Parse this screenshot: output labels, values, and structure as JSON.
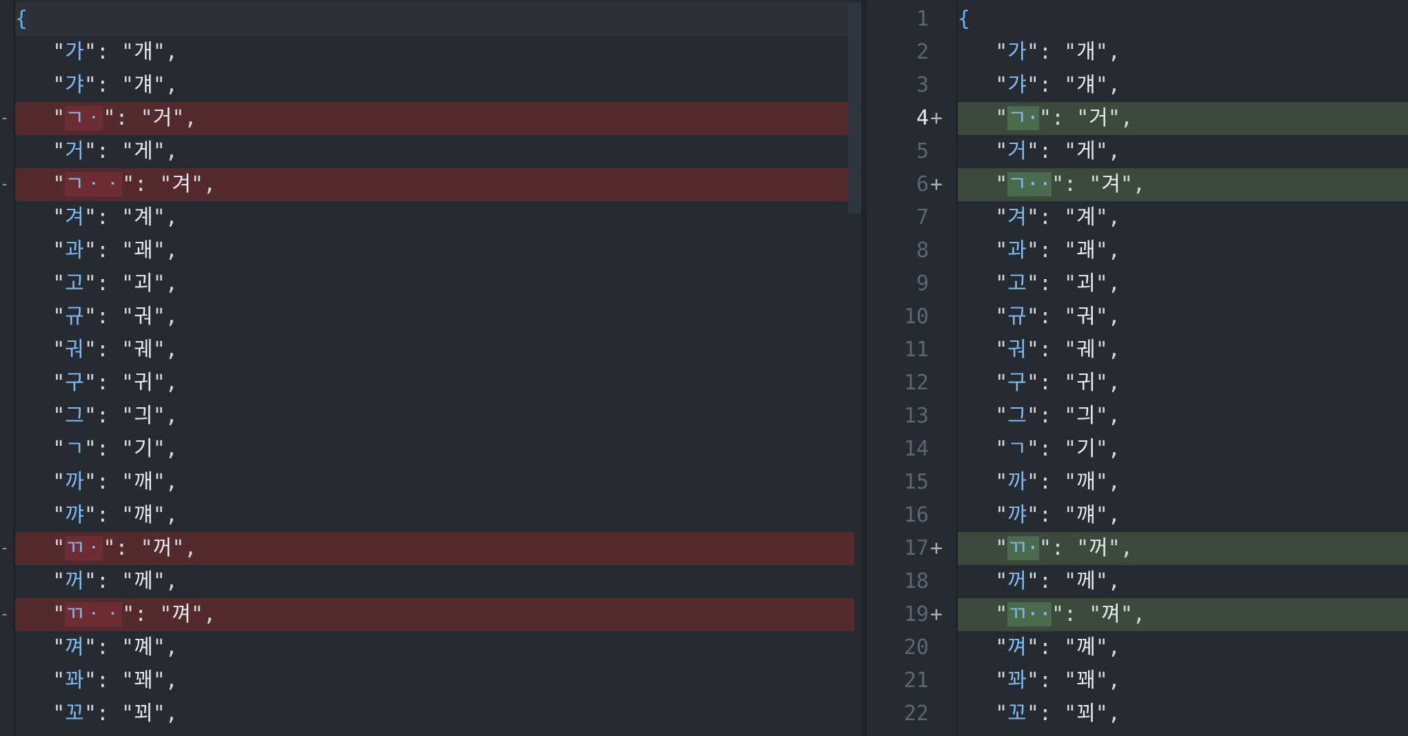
{
  "left": {
    "lines": [
      {
        "type": "brace",
        "text": "{"
      },
      {
        "type": "ctx",
        "key": "가",
        "val": "개"
      },
      {
        "type": "ctx",
        "key": "갸",
        "val": "걔"
      },
      {
        "type": "del",
        "key": "ㄱㆍ",
        "val": "거",
        "hl": "ㄱㆍ"
      },
      {
        "type": "ctx",
        "key": "거",
        "val": "게"
      },
      {
        "type": "del",
        "key": "ㄱㆍㆍ",
        "val": "겨",
        "hl": "ㄱㆍㆍ"
      },
      {
        "type": "ctx",
        "key": "겨",
        "val": "계"
      },
      {
        "type": "ctx",
        "key": "과",
        "val": "괘"
      },
      {
        "type": "ctx",
        "key": "고",
        "val": "괴"
      },
      {
        "type": "ctx",
        "key": "규",
        "val": "궈"
      },
      {
        "type": "ctx",
        "key": "궈",
        "val": "궤"
      },
      {
        "type": "ctx",
        "key": "구",
        "val": "귀"
      },
      {
        "type": "ctx",
        "key": "그",
        "val": "긔"
      },
      {
        "type": "ctx",
        "key": "ㄱ",
        "val": "기"
      },
      {
        "type": "ctx",
        "key": "까",
        "val": "깨"
      },
      {
        "type": "ctx",
        "key": "꺄",
        "val": "꺠"
      },
      {
        "type": "del",
        "key": "ㄲㆍ",
        "val": "꺼",
        "hl": "ㄲㆍ"
      },
      {
        "type": "ctx",
        "key": "꺼",
        "val": "께"
      },
      {
        "type": "del",
        "key": "ㄲㆍㆍ",
        "val": "껴",
        "hl": "ㄲㆍㆍ"
      },
      {
        "type": "ctx",
        "key": "껴",
        "val": "꼐"
      },
      {
        "type": "ctx",
        "key": "꽈",
        "val": "꽤"
      },
      {
        "type": "ctx",
        "key": "꼬",
        "val": "꾀"
      }
    ]
  },
  "right": {
    "lines": [
      {
        "n": "1",
        "type": "brace",
        "text": "{"
      },
      {
        "n": "2",
        "type": "ctx",
        "key": "가",
        "val": "개"
      },
      {
        "n": "3",
        "type": "ctx",
        "key": "갸",
        "val": "걔"
      },
      {
        "n": "4",
        "type": "add",
        "key": "ㄱ·",
        "val": "거",
        "active": true
      },
      {
        "n": "5",
        "type": "ctx",
        "key": "거",
        "val": "게"
      },
      {
        "n": "6",
        "type": "add",
        "key": "ㄱ··",
        "val": "겨"
      },
      {
        "n": "7",
        "type": "ctx",
        "key": "겨",
        "val": "계"
      },
      {
        "n": "8",
        "type": "ctx",
        "key": "과",
        "val": "괘"
      },
      {
        "n": "9",
        "type": "ctx",
        "key": "고",
        "val": "괴"
      },
      {
        "n": "10",
        "type": "ctx",
        "key": "규",
        "val": "궈"
      },
      {
        "n": "11",
        "type": "ctx",
        "key": "궈",
        "val": "궤"
      },
      {
        "n": "12",
        "type": "ctx",
        "key": "구",
        "val": "귀"
      },
      {
        "n": "13",
        "type": "ctx",
        "key": "그",
        "val": "긔"
      },
      {
        "n": "14",
        "type": "ctx",
        "key": "ㄱ",
        "val": "기"
      },
      {
        "n": "15",
        "type": "ctx",
        "key": "까",
        "val": "깨"
      },
      {
        "n": "16",
        "type": "ctx",
        "key": "꺄",
        "val": "꺠"
      },
      {
        "n": "17",
        "type": "add",
        "key": "ㄲ·",
        "val": "꺼"
      },
      {
        "n": "18",
        "type": "ctx",
        "key": "꺼",
        "val": "께"
      },
      {
        "n": "19",
        "type": "add",
        "key": "ㄲ··",
        "val": "껴"
      },
      {
        "n": "20",
        "type": "ctx",
        "key": "껴",
        "val": "꼐"
      },
      {
        "n": "21",
        "type": "ctx",
        "key": "꽈",
        "val": "꽤"
      },
      {
        "n": "22",
        "type": "ctx",
        "key": "꼬",
        "val": "꾀"
      }
    ],
    "plus_marker": "+"
  },
  "left_marker": "-",
  "colors": {
    "background": "#262b32",
    "deleted_line": "#552a2d",
    "added_line": "#3c4a3c",
    "key": "#7fbcf5",
    "value": "#e8ebef"
  }
}
